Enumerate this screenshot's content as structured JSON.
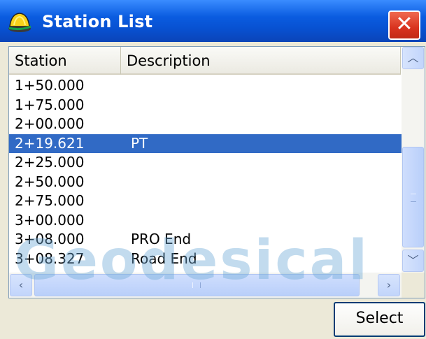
{
  "window": {
    "title": "Station List",
    "icon": "helmet-icon",
    "close_label": "✕"
  },
  "columns": [
    {
      "label": "Station"
    },
    {
      "label": "Description"
    }
  ],
  "rows": [
    {
      "station": "1+50.000",
      "description": ""
    },
    {
      "station": "1+75.000",
      "description": ""
    },
    {
      "station": "2+00.000",
      "description": ""
    },
    {
      "station": "2+19.621",
      "description": "PT",
      "selected": true
    },
    {
      "station": "2+25.000",
      "description": ""
    },
    {
      "station": "2+50.000",
      "description": ""
    },
    {
      "station": "2+75.000",
      "description": ""
    },
    {
      "station": "3+00.000",
      "description": ""
    },
    {
      "station": "3+08.000",
      "description": "PRO End"
    },
    {
      "station": "3+08.327",
      "description": "Road End"
    }
  ],
  "scrollbars": {
    "up_arrow": "up-arrow-icon",
    "down_arrow": "down-arrow-icon",
    "left_arrow": "left-arrow-icon",
    "right_arrow": "right-arrow-icon"
  },
  "watermark": "Geodesical",
  "actions": {
    "select_label": "Select"
  },
  "colors": {
    "titlebar": "#0850d0",
    "selection": "#316ac5",
    "close": "#d9331f"
  }
}
